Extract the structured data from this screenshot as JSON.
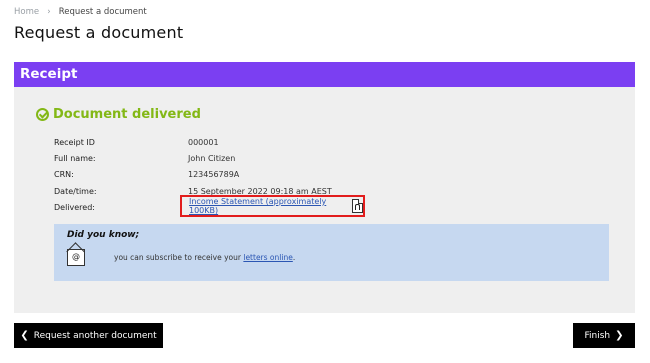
{
  "breadcrumb": {
    "home": "Home",
    "current": "Request a document"
  },
  "page_title": "Request a document",
  "receipt": {
    "header": "Receipt",
    "status_title": "Document delivered",
    "fields": [
      {
        "label": "Receipt ID",
        "value": "000001"
      },
      {
        "label": "Full name:",
        "value": "John Citizen"
      },
      {
        "label": "CRN:",
        "value": "123456789A"
      },
      {
        "label": "Date/time:",
        "value": "15 September 2022 09:18 am AEST"
      },
      {
        "label": "Delivered:",
        "value": ""
      }
    ],
    "delivered_link": "Income Statement (approximately 100KB)"
  },
  "info": {
    "title": "Did you know;",
    "text_before": "you can subscribe to receive your ",
    "link": "letters online",
    "text_after": "."
  },
  "buttons": {
    "back": "Request another document",
    "finish": "Finish"
  },
  "icons": [
    "check-circle-icon",
    "pdf-icon",
    "mail-icon",
    "chevron-left-icon",
    "chevron-right-icon"
  ],
  "colors": {
    "header": "#7b3ff2",
    "success": "#83b816",
    "highlight_border": "#e21d1d",
    "info_bg": "#c6d8f0",
    "link": "#2b56b3"
  }
}
